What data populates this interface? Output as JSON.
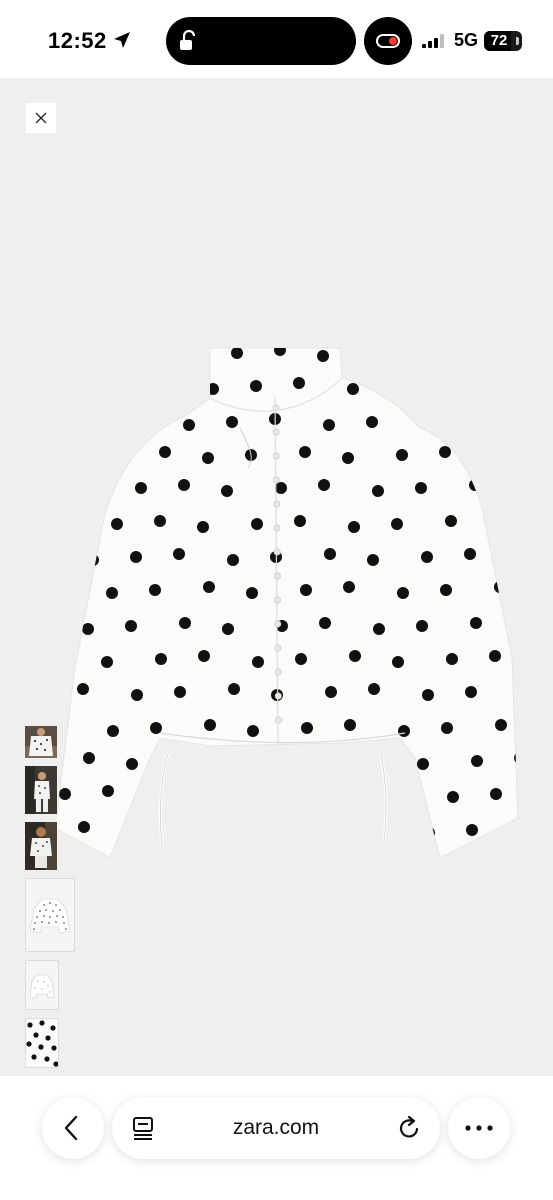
{
  "status_bar": {
    "time": "12:52",
    "network": "5G",
    "battery": "72",
    "battery_level": 0.72
  },
  "viewer": {
    "product_image": "polka-dot-jacket",
    "thumbnail_count": 6
  },
  "browser": {
    "url": "zara.com"
  },
  "colors": {
    "viewer_background": "#efefef",
    "recording_indicator": "#ff3b30"
  }
}
